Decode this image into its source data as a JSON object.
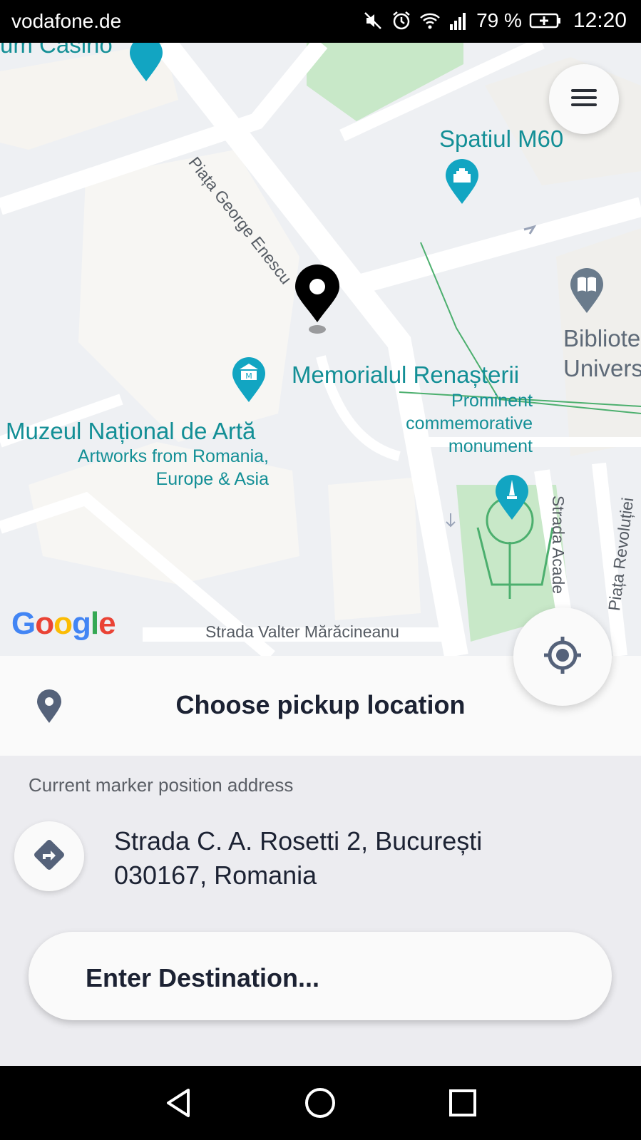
{
  "status_bar": {
    "carrier": "vodafone.de",
    "battery_pct": "79 %",
    "time": "12:20",
    "icons": [
      "mute-icon",
      "alarm-icon",
      "wifi-icon",
      "signal-icon",
      "battery-charging-icon"
    ]
  },
  "map": {
    "menu_icon": "hamburger-menu-icon",
    "labels": {
      "casino": "um Casino",
      "spatiul": "Spatiul M60",
      "piata_enescu": "Piața George Enescu",
      "biblioteca_1": "Bibliote",
      "biblioteca_2": "Univers",
      "memorialul": "Memorialul Renașterii",
      "memorialul_sub_1": "Prominent",
      "memorialul_sub_2": "commemorative",
      "memorialul_sub_3": "monument",
      "muzeul": "Muzeul Național de Artă",
      "muzeul_sub_1": "Artworks from Romania,",
      "muzeul_sub_2": "Europe & Asia",
      "strada_acad": "Strada Acade",
      "piata_revolutiei": "Piața Revoluției",
      "strada_valter": "Strada Valter Mărăcineanu"
    },
    "logo_letters": [
      "G",
      "o",
      "o",
      "g",
      "l",
      "e"
    ],
    "accent_color": "#138f96"
  },
  "pickup": {
    "title": "Choose pickup location",
    "pin_icon": "location-pin-icon",
    "locate_icon": "my-location-icon"
  },
  "address": {
    "caption": "Current marker position address",
    "text": "Strada C. A. Rosetti 2, București\n030167, Romania",
    "direction_icon": "directions-icon"
  },
  "destination": {
    "label": "Enter Destination..."
  },
  "nav": {
    "icons": [
      "back-icon",
      "home-icon",
      "recents-icon"
    ]
  }
}
